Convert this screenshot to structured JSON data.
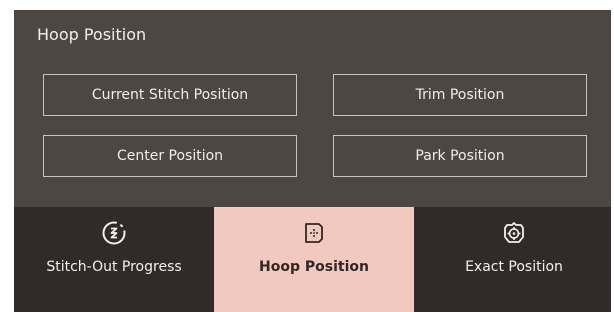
{
  "panel": {
    "title": "Hoop Position",
    "buttons": {
      "current_stitch": "Current Stitch Position",
      "trim": "Trim Position",
      "center": "Center Position",
      "park": "Park Position"
    }
  },
  "tabs": [
    {
      "label": "Stitch-Out Progress",
      "icon": "stitch-out-progress-icon",
      "active": false
    },
    {
      "label": "Hoop Position",
      "icon": "hoop-position-icon",
      "active": true
    },
    {
      "label": "Exact Position",
      "icon": "exact-position-icon",
      "active": false
    }
  ],
  "colors": {
    "panel_bg": "#4d4743",
    "tabbar_bg": "#302b29",
    "active_tab_bg": "#f2c9bf",
    "text_light": "#f3f0ec"
  }
}
